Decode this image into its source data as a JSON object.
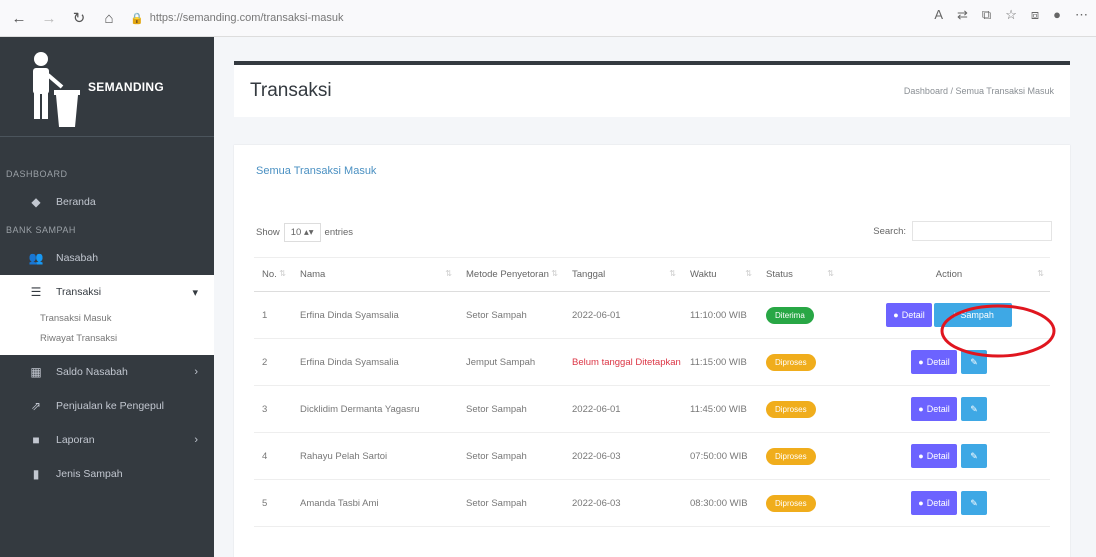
{
  "browser": {
    "url": "https://semanding.com/transaksi-masuk"
  },
  "sidebar": {
    "brand": "SEMANDING",
    "sections": [
      {
        "header": "DASHBOARD"
      },
      {
        "header": "BANK SAMPAH"
      }
    ],
    "items": [
      {
        "label": "Beranda",
        "icon": "tachometer-icon"
      },
      {
        "label": "Nasabah",
        "icon": "users-icon"
      },
      {
        "label": "Transaksi",
        "icon": "list-icon"
      },
      {
        "label": "Saldo Nasabah",
        "icon": "wallet-icon"
      },
      {
        "label": "Penjualan ke Pengepul",
        "icon": "chart-icon"
      },
      {
        "label": "Laporan",
        "icon": "report-icon"
      },
      {
        "label": "Jenis Sampah",
        "icon": "trash-icon"
      }
    ],
    "sub_items": [
      "Transaksi Masuk",
      "Riwayat Transaksi"
    ]
  },
  "header": {
    "title": "Transaksi",
    "breadcrumb": "Dashboard / Semua Transaksi Masuk"
  },
  "card": {
    "title": "Semua Transaksi Masuk",
    "show_label": "Show",
    "entries_value": "10",
    "entries_label": "entries",
    "search_label": "Search:"
  },
  "table": {
    "columns": [
      "No.",
      "Nama",
      "Metode Penyetoran",
      "Tanggal",
      "Waktu",
      "Status",
      "Action"
    ],
    "rows": [
      {
        "no": "1",
        "nama": "Erfina Dinda Syamsalia",
        "metode": "Setor Sampah",
        "tanggal": "2022-06-01",
        "waktu": "11:10:00 WIB",
        "status": "Diterima"
      },
      {
        "no": "2",
        "nama": "Erfina Dinda Syamsalia",
        "metode": "Jemput Sampah",
        "tanggal": "Belum tanggal Ditetapkan",
        "waktu": "11:15:00 WIB",
        "status": "Diproses"
      },
      {
        "no": "3",
        "nama": "Dicklidim Dermanta Yagasru",
        "metode": "Setor Sampah",
        "tanggal": "2022-06-01",
        "waktu": "11:45:00 WIB",
        "status": "Diproses"
      },
      {
        "no": "4",
        "nama": "Rahayu Pelah Sartoi",
        "metode": "Setor Sampah",
        "tanggal": "2022-06-03",
        "waktu": "07:50:00 WIB",
        "status": "Diproses"
      },
      {
        "no": "5",
        "nama": "Amanda Tasbi Ami",
        "metode": "Setor Sampah",
        "tanggal": "2022-06-03",
        "waktu": "08:30:00 WIB",
        "status": "Diproses"
      }
    ],
    "detail_label": "Detail",
    "add_label": "Sampah"
  },
  "colors": {
    "sidebar": "#343a40",
    "accent": "#3ea8e5",
    "detail": "#6c63ff",
    "success": "#28a745",
    "warning": "#f0ad1c",
    "annotation": "#e0161f"
  }
}
